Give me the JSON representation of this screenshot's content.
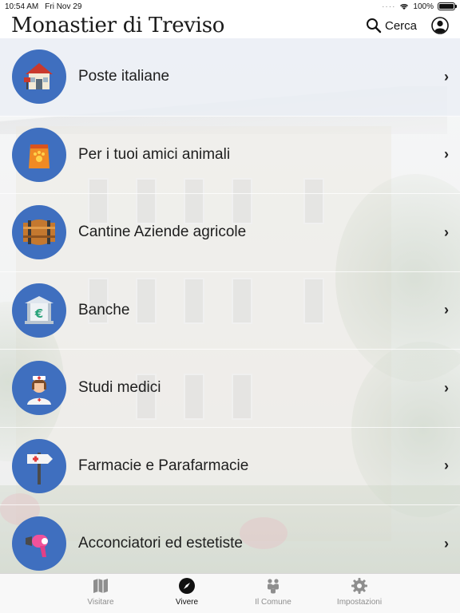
{
  "status_bar": {
    "time": "10:54 AM",
    "date": "Fri Nov 29",
    "battery": "100%",
    "battery_level": 1.0
  },
  "header": {
    "title": "Monastier di Treviso",
    "search_label": "Cerca"
  },
  "list": {
    "items": [
      {
        "label": "Poste italiane",
        "icon": "post-office-icon"
      },
      {
        "label": "Per i tuoi amici animali",
        "icon": "pet-food-icon"
      },
      {
        "label": "Cantine Aziende agricole",
        "icon": "wine-barrel-icon"
      },
      {
        "label": "Banche",
        "icon": "bank-euro-icon"
      },
      {
        "label": "Studi medici",
        "icon": "nurse-icon"
      },
      {
        "label": "Farmacie e Parafarmacie",
        "icon": "pharmacy-sign-icon"
      },
      {
        "label": "Acconciatori ed estetiste",
        "icon": "hair-dryer-icon"
      }
    ]
  },
  "tabs": [
    {
      "label": "Visitare",
      "icon": "map-icon",
      "active": false
    },
    {
      "label": "Vivere",
      "icon": "compass-icon",
      "active": true
    },
    {
      "label": "Il Comune",
      "icon": "people-icon",
      "active": false
    },
    {
      "label": "Impostazioni",
      "icon": "gear-icon",
      "active": false
    }
  ],
  "colors": {
    "accent": "#3f6fbf",
    "background": "#e9eaeb"
  }
}
